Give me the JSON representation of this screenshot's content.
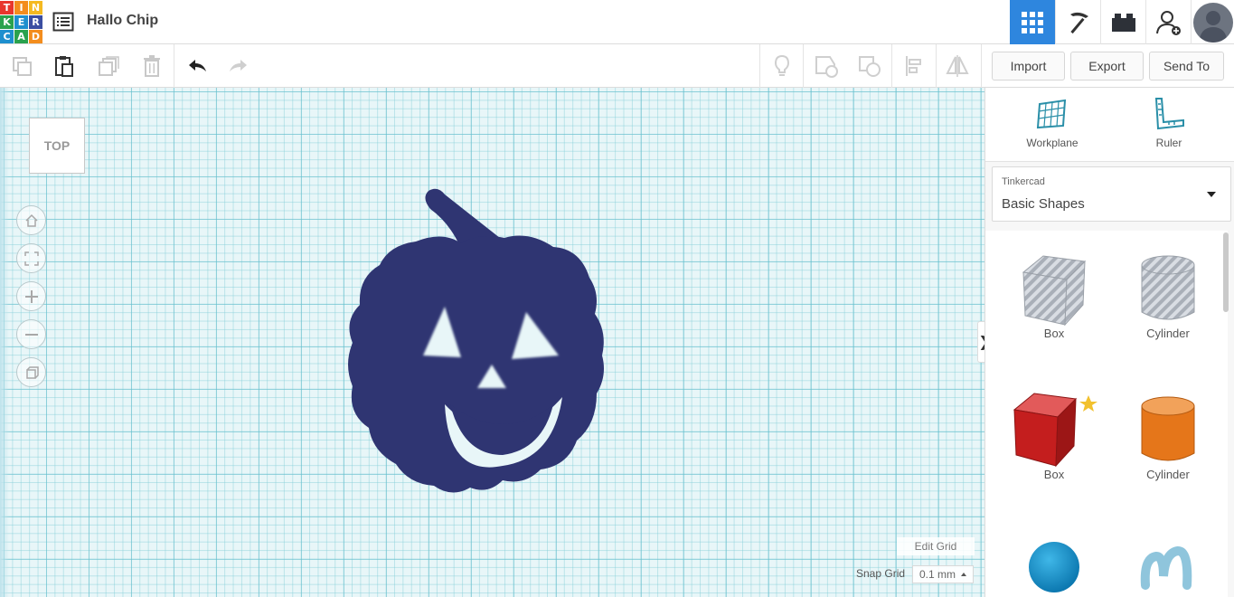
{
  "app": {
    "logo_letters": [
      "T",
      "I",
      "N",
      "K",
      "E",
      "R",
      "C",
      "A",
      "D"
    ],
    "logo_colors": [
      "#e8362d",
      "#f38d1e",
      "#f5b921",
      "#2aa24e",
      "#1e8fce",
      "#3b4ea1",
      "#1e8fce",
      "#2aa24e",
      "#f38d1e"
    ],
    "project_title": "Hallo Chip"
  },
  "topbar": {
    "icons": [
      "grid-icon",
      "pickaxe-icon",
      "brick-icon",
      "add-user-icon"
    ],
    "active_color": "#2e86de"
  },
  "toolbar": {
    "import_label": "Import",
    "export_label": "Export",
    "send_to_label": "Send To"
  },
  "canvas": {
    "view_label": "TOP",
    "edit_grid_label": "Edit Grid",
    "snap_grid_label": "Snap Grid",
    "snap_grid_value": "0.1 mm",
    "shape_color": "#2f3572"
  },
  "panel": {
    "workplane_label": "Workplane",
    "ruler_label": "Ruler",
    "library_source": "Tinkercad",
    "library_name": "Basic Shapes",
    "shapes": [
      {
        "label": "Box"
      },
      {
        "label": "Cylinder"
      },
      {
        "label": "Box"
      },
      {
        "label": "Cylinder"
      }
    ]
  }
}
